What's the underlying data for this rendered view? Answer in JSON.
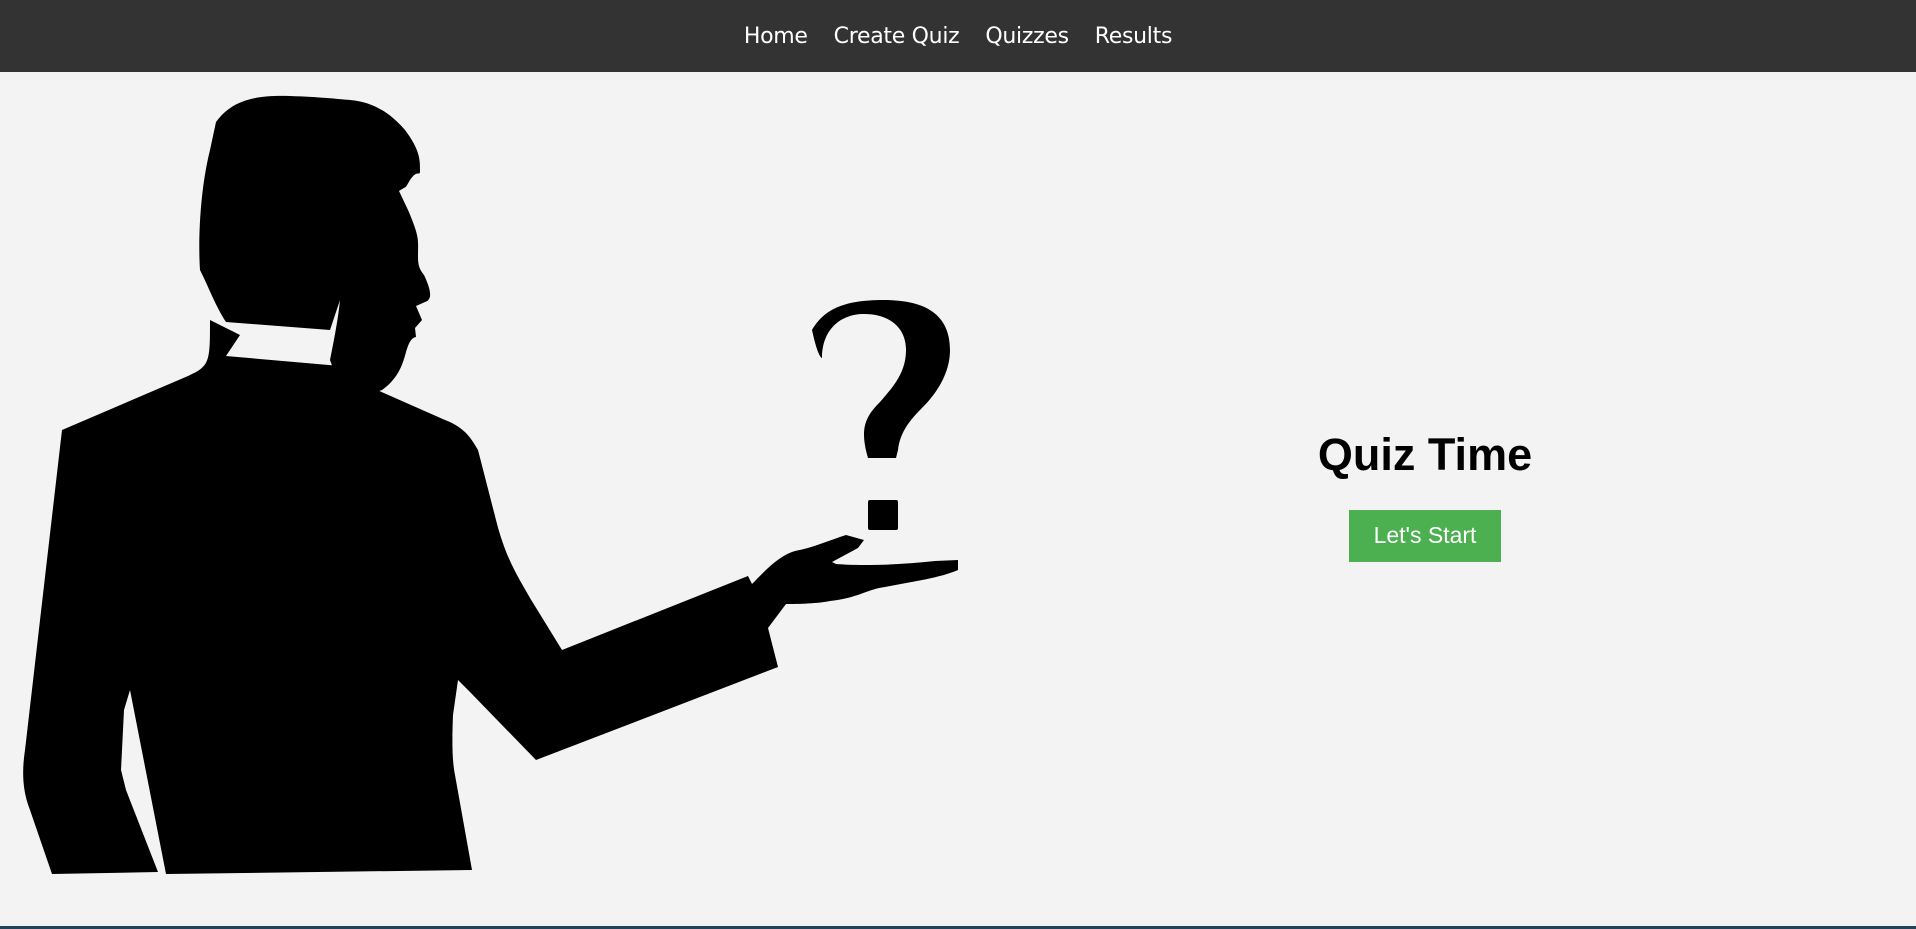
{
  "nav": {
    "items": [
      {
        "label": "Home"
      },
      {
        "label": "Create Quiz"
      },
      {
        "label": "Quizzes"
      },
      {
        "label": "Results"
      }
    ]
  },
  "hero": {
    "title": "Quiz Time",
    "start_button": "Let's Start",
    "accent_color": "#4caf50"
  },
  "illustration": {
    "icon": "question-presenter-silhouette"
  },
  "colors": {
    "navbar": "#333333",
    "background": "#f3f3f3"
  }
}
